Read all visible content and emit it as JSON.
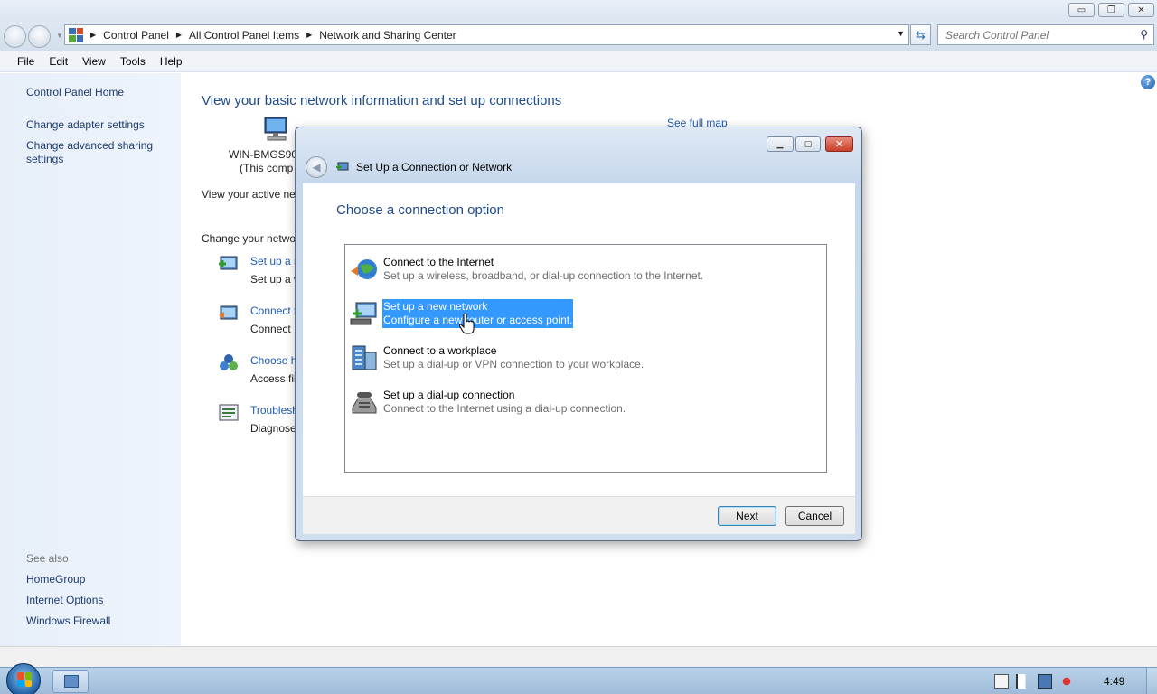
{
  "explorer": {
    "breadcrumbs": [
      "Control Panel",
      "All Control Panel Items",
      "Network and Sharing Center"
    ],
    "search_placeholder": "Search Control Panel",
    "menu": [
      "File",
      "Edit",
      "View",
      "Tools",
      "Help"
    ],
    "window_controls": {
      "minimize": "▭",
      "maximize": "❐",
      "close": "✕"
    }
  },
  "sidebar": {
    "home": "Control Panel Home",
    "links": [
      "Change adapter settings",
      "Change advanced sharing settings"
    ],
    "see_also_heading": "See also",
    "see_also": [
      "HomeGroup",
      "Internet Options",
      "Windows Firewall"
    ]
  },
  "main": {
    "title": "View your basic network information and set up connections",
    "see_full_map": "See full map",
    "computer_name": "WIN-BMGS90",
    "computer_sub": "(This comp",
    "active_networks": "View your active ne",
    "change_networking": "Change your netwo",
    "tasks": [
      {
        "link": "Set up a n",
        "desc": "Set up a w"
      },
      {
        "link": "Connect t",
        "desc": "Connect"
      },
      {
        "link": "Choose h",
        "desc": "Access fil"
      },
      {
        "link": "Troublesh",
        "desc": "Diagnose"
      }
    ]
  },
  "dialog": {
    "title": "Set Up a Connection or Network",
    "heading": "Choose a connection option",
    "options": [
      {
        "title": "Connect to the Internet",
        "desc": "Set up a wireless, broadband, or dial-up connection to the Internet.",
        "icon": "globe-icon"
      },
      {
        "title": "Set up a new network",
        "desc": "Configure a new router or access point.",
        "icon": "network-router-icon"
      },
      {
        "title": "Connect to a workplace",
        "desc": "Set up a dial-up or VPN connection to your workplace.",
        "icon": "workplace-building-icon"
      },
      {
        "title": "Set up a dial-up connection",
        "desc": "Connect to the Internet using a dial-up connection.",
        "icon": "phone-modem-icon"
      }
    ],
    "selected_index": 1,
    "next_button": "Next",
    "cancel_button": "Cancel"
  },
  "taskbar": {
    "clock": "4:49"
  }
}
